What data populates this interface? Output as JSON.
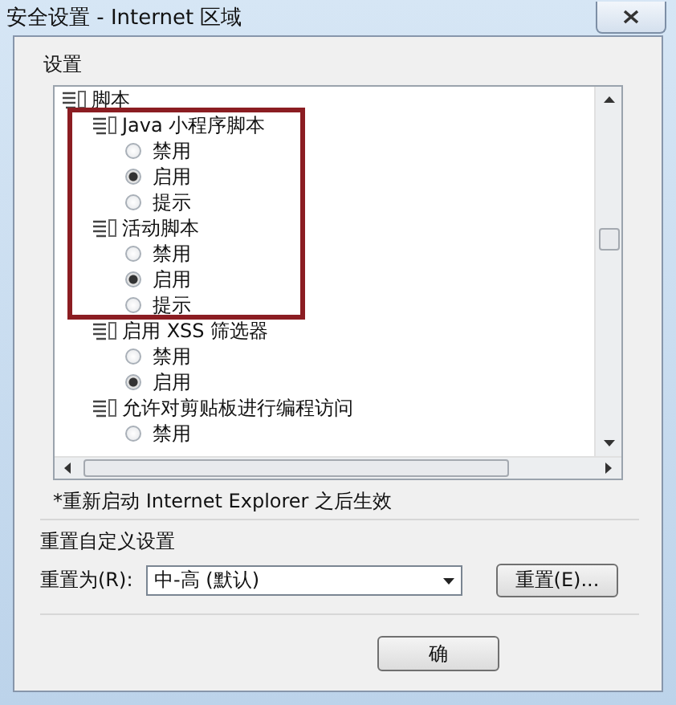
{
  "window": {
    "title": "安全设置 - Internet 区域"
  },
  "settings": {
    "label": "设置",
    "tree": [
      {
        "label": "脚本",
        "children": [
          {
            "label": "Java 小程序脚本",
            "highlighted": true,
            "options": [
              {
                "label": "禁用",
                "selected": false
              },
              {
                "label": "启用",
                "selected": true
              },
              {
                "label": "提示",
                "selected": false
              }
            ]
          },
          {
            "label": "活动脚本",
            "highlighted": true,
            "options": [
              {
                "label": "禁用",
                "selected": false
              },
              {
                "label": "启用",
                "selected": true
              },
              {
                "label": "提示",
                "selected": false
              }
            ]
          },
          {
            "label": "启用 XSS 筛选器",
            "highlighted": false,
            "options": [
              {
                "label": "禁用",
                "selected": false
              },
              {
                "label": "启用",
                "selected": true
              }
            ]
          },
          {
            "label": "允许对剪贴板进行编程访问",
            "highlighted": false,
            "options": [
              {
                "label": "禁用",
                "selected": false
              }
            ]
          }
        ]
      }
    ]
  },
  "note": "*重新启动 Internet Explorer 之后生效",
  "reset": {
    "title": "重置自定义设置",
    "label": "重置为(R):",
    "value": "中-高 (默认)",
    "button": "重置(E)..."
  },
  "buttons": [
    "确"
  ]
}
